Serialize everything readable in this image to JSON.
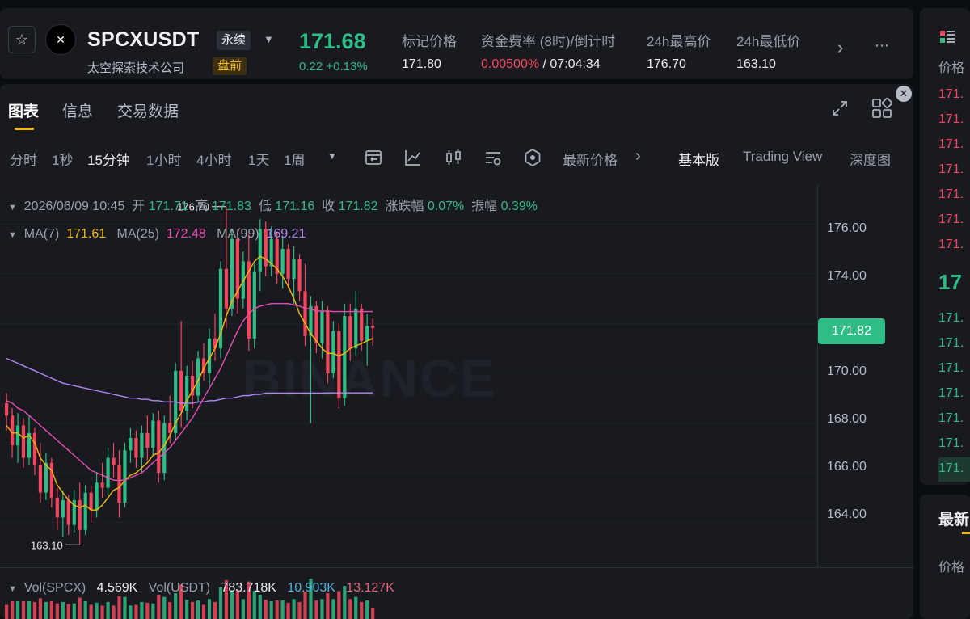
{
  "header": {
    "symbol": "SPCXUSDT",
    "contract_type": "永续",
    "company": "太空探索技术公司",
    "session_badge": "盘前",
    "last_price": "171.68",
    "change": "0.22 +0.13%",
    "stats": [
      {
        "label": "标记价格",
        "value": "171.80"
      },
      {
        "label": "资金费率 (8时)/倒计时",
        "rate": "0.00500%",
        "sep": " / ",
        "countdown": "07:04:34"
      },
      {
        "label": "24h最高价",
        "value": "176.70"
      },
      {
        "label": "24h最低价",
        "value": "163.10"
      }
    ],
    "colors": {
      "up": "#2ebd85",
      "down": "#f6465d",
      "brand": "#f0b90b"
    }
  },
  "tabs": [
    "图表",
    "信息",
    "交易数据"
  ],
  "toolbar": {
    "intervals": [
      "分时",
      "1秒",
      "15分钟",
      "1小时",
      "4小时",
      "1天",
      "1周"
    ],
    "active_interval": "15分钟",
    "price_type": "最新价格",
    "modes": [
      "基本版",
      "Trading View",
      "深度图"
    ],
    "active_mode": "基本版"
  },
  "ohlc": {
    "datetime": "2026/06/09 10:45",
    "open_label": "开",
    "open": "171.71",
    "high_label": "高",
    "high": "171.83",
    "low_label": "低",
    "low": "171.16",
    "close_label": "收",
    "close": "171.82",
    "chg_label": "涨跌幅",
    "chg": "0.07%",
    "amp_label": "振幅",
    "amp": "0.39%"
  },
  "ma": [
    {
      "label": "MA(7)",
      "value": "171.61",
      "color": "#f0b90b"
    },
    {
      "label": "MA(25)",
      "value": "172.48",
      "color": "#e64db0"
    },
    {
      "label": "MA(99)",
      "value": "169.21",
      "color": "#b287f0"
    }
  ],
  "volume": {
    "vol_spcx_label": "Vol(SPCX)",
    "vol_spcx": "4.569K",
    "vol_usdt_label": "Vol(USDT)",
    "vol_usdt": "783.718K",
    "ma5": "10.903K",
    "ma10": "13.127K"
  },
  "chart_data": {
    "type": "candlestick",
    "y_ticks": [
      "176.00",
      "174.00",
      "172.00",
      "170.00",
      "168.00",
      "166.00",
      "164.00"
    ],
    "ylim": [
      162.2,
      177.6
    ],
    "current_price": "171.82",
    "high_marker": "176.70",
    "low_marker": "163.10",
    "watermark": "BINANCE",
    "candles": [
      [
        168.8,
        169.2,
        167.7,
        168.3
      ],
      [
        168.3,
        168.6,
        166.6,
        167.1
      ],
      [
        167.1,
        168.4,
        166.4,
        167.9
      ],
      [
        167.9,
        168.2,
        166.2,
        166.6
      ],
      [
        166.6,
        168.3,
        166.3,
        167.6
      ],
      [
        167.6,
        167.8,
        165.9,
        166.3
      ],
      [
        166.3,
        167.2,
        164.8,
        165.2
      ],
      [
        165.2,
        166.8,
        164.9,
        166.4
      ],
      [
        166.4,
        166.6,
        164.6,
        165.0
      ],
      [
        165.0,
        165.4,
        163.7,
        164.2
      ],
      [
        164.2,
        165.3,
        163.4,
        164.9
      ],
      [
        164.9,
        165.1,
        163.5,
        163.9
      ],
      [
        163.9,
        165.3,
        163.6,
        164.9
      ],
      [
        164.9,
        165.6,
        163.1,
        163.7
      ],
      [
        163.7,
        165.5,
        163.5,
        165.2
      ],
      [
        165.2,
        165.5,
        164.0,
        164.5
      ],
      [
        164.5,
        166.0,
        164.2,
        165.6
      ],
      [
        165.6,
        166.4,
        165.0,
        165.4
      ],
      [
        165.4,
        167.0,
        165.1,
        166.6
      ],
      [
        166.6,
        167.2,
        165.8,
        166.3
      ],
      [
        166.3,
        166.9,
        164.2,
        164.8
      ],
      [
        164.8,
        167.2,
        164.6,
        166.9
      ],
      [
        166.9,
        167.8,
        166.4,
        167.4
      ],
      [
        167.4,
        167.7,
        166.2,
        166.6
      ],
      [
        166.6,
        167.9,
        166.0,
        167.6
      ],
      [
        167.6,
        168.3,
        166.5,
        167.0
      ],
      [
        167.0,
        168.4,
        166.7,
        168.1
      ],
      [
        168.1,
        168.5,
        165.6,
        166.0
      ],
      [
        166.0,
        168.3,
        165.7,
        168.0
      ],
      [
        168.0,
        169.1,
        167.2,
        167.6
      ],
      [
        167.6,
        170.4,
        167.3,
        170.1
      ],
      [
        170.1,
        172.1,
        167.8,
        168.5
      ],
      [
        168.5,
        170.3,
        168.1,
        169.9
      ],
      [
        169.9,
        170.5,
        168.6,
        169.1
      ],
      [
        169.1,
        170.9,
        168.8,
        170.6
      ],
      [
        170.6,
        171.2,
        169.7,
        170.0
      ],
      [
        170.0,
        171.8,
        169.5,
        171.4
      ],
      [
        171.4,
        172.4,
        170.5,
        171.0
      ],
      [
        171.0,
        174.5,
        170.6,
        174.2
      ],
      [
        174.2,
        176.7,
        171.8,
        172.6
      ],
      [
        172.6,
        175.8,
        172.3,
        175.4
      ],
      [
        175.4,
        175.8,
        172.4,
        173.0
      ],
      [
        173.0,
        174.9,
        172.6,
        174.5
      ],
      [
        174.5,
        175.6,
        170.9,
        171.4
      ],
      [
        171.4,
        174.4,
        171.0,
        174.1
      ],
      [
        174.1,
        176.2,
        173.3,
        175.8
      ],
      [
        175.8,
        176.1,
        173.9,
        174.3
      ],
      [
        174.3,
        175.9,
        173.9,
        175.4
      ],
      [
        175.4,
        175.7,
        173.6,
        174.0
      ],
      [
        174.0,
        175.5,
        173.4,
        175.0
      ],
      [
        175.0,
        175.2,
        173.4,
        173.8
      ],
      [
        173.8,
        175.1,
        172.8,
        174.6
      ],
      [
        174.6,
        174.8,
        172.9,
        173.3
      ],
      [
        173.3,
        174.4,
        171.1,
        171.5
      ],
      [
        171.5,
        173.1,
        168.0,
        172.7
      ],
      [
        172.7,
        172.9,
        170.8,
        171.2
      ],
      [
        171.2,
        172.9,
        170.6,
        172.5
      ],
      [
        172.5,
        172.7,
        169.6,
        170.0
      ],
      [
        170.0,
        172.1,
        169.8,
        171.7
      ],
      [
        171.7,
        172.0,
        168.6,
        169.0
      ],
      [
        169.0,
        172.8,
        168.7,
        172.3
      ],
      [
        172.3,
        172.8,
        170.5,
        171.0
      ],
      [
        171.0,
        173.3,
        170.7,
        172.6
      ],
      [
        172.6,
        172.8,
        170.9,
        171.3
      ],
      [
        171.3,
        172.4,
        170.3,
        171.9
      ],
      [
        171.9,
        172.2,
        171.1,
        171.82
      ]
    ],
    "ma_series": {
      "ma7": [
        167.9,
        167.6,
        167.6,
        167.4,
        167.5,
        167.2,
        166.6,
        166.3,
        166.1,
        165.5,
        165.2,
        164.9,
        164.7,
        164.6,
        164.7,
        164.5,
        164.5,
        164.7,
        165.0,
        165.3,
        165.4,
        165.7,
        165.9,
        166.0,
        166.2,
        166.4,
        166.7,
        166.8,
        167.1,
        167.5,
        168.0,
        168.4,
        168.9,
        169.3,
        169.7,
        170.2,
        170.6,
        171.0,
        171.6,
        172.3,
        172.9,
        173.3,
        173.7,
        174.1,
        174.5,
        174.7,
        174.6,
        174.4,
        174.2,
        173.9,
        173.5,
        173.0,
        172.4,
        172.0,
        171.6,
        171.3,
        171.0,
        170.8,
        170.8,
        170.7,
        170.8,
        171.0,
        171.1,
        171.2,
        171.3,
        171.4
      ],
      "ma25": [
        168.9,
        168.8,
        168.6,
        168.5,
        168.3,
        168.1,
        167.9,
        167.7,
        167.5,
        167.3,
        167.1,
        166.9,
        166.7,
        166.5,
        166.3,
        166.1,
        166.0,
        165.9,
        165.8,
        165.7,
        165.7,
        165.7,
        165.8,
        165.9,
        166.0,
        166.2,
        166.4,
        166.6,
        166.8,
        167.0,
        167.3,
        167.6,
        167.9,
        168.2,
        168.6,
        169.0,
        169.4,
        169.8,
        170.2,
        170.7,
        171.2,
        171.7,
        172.1,
        172.4,
        172.6,
        172.7,
        172.75,
        172.8,
        172.8,
        172.8,
        172.8,
        172.75,
        172.7,
        172.6,
        172.6,
        172.5,
        172.5,
        172.5,
        172.48,
        172.48,
        172.48,
        172.48,
        172.48,
        172.48,
        172.48,
        172.48
      ],
      "ma99": [
        170.6,
        170.5,
        170.4,
        170.3,
        170.2,
        170.1,
        170.0,
        169.9,
        169.8,
        169.7,
        169.6,
        169.55,
        169.5,
        169.45,
        169.4,
        169.35,
        169.3,
        169.25,
        169.2,
        169.15,
        169.1,
        169.05,
        169.0,
        169.0,
        168.95,
        168.95,
        168.9,
        168.9,
        168.85,
        168.85,
        168.85,
        168.8,
        168.8,
        168.8,
        168.85,
        168.85,
        168.9,
        168.9,
        168.95,
        169.0,
        169.0,
        169.05,
        169.1,
        169.1,
        169.15,
        169.15,
        169.2,
        169.2,
        169.2,
        169.2,
        169.2,
        169.2,
        169.2,
        169.2,
        169.2,
        169.2,
        169.2,
        169.21,
        169.21,
        169.21,
        169.21,
        169.21,
        169.21,
        169.21,
        169.21,
        169.21
      ]
    }
  },
  "orderbook": {
    "price_label": "价格",
    "asks": [
      "171.",
      "171.",
      "171.",
      "171.",
      "171.",
      "171.",
      "171."
    ],
    "mid": "17",
    "bids": [
      "171.",
      "171.",
      "171.",
      "171.",
      "171.",
      "171.",
      "171."
    ],
    "recent_label": "最新",
    "price_label_2": "价格"
  }
}
